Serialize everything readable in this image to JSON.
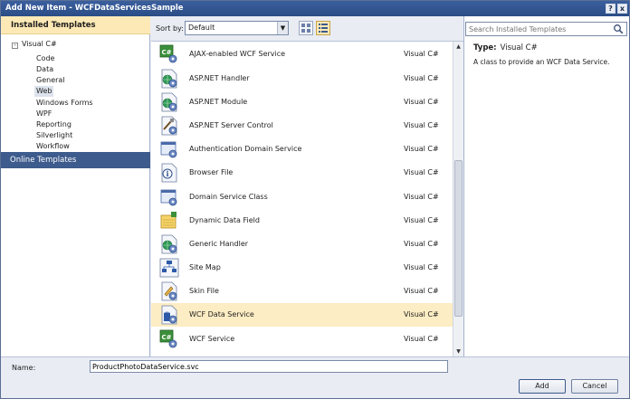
{
  "window": {
    "title": "Add New Item - WCFDataServicesSample",
    "help_label": "?",
    "close_label": "x"
  },
  "left": {
    "installed_header": "Installed Templates",
    "root": "Visual C#",
    "root_toggle": "-",
    "items": [
      {
        "label": "Code"
      },
      {
        "label": "Data"
      },
      {
        "label": "General"
      },
      {
        "label": "Web"
      },
      {
        "label": "Windows Forms"
      },
      {
        "label": "WPF"
      },
      {
        "label": "Reporting"
      },
      {
        "label": "Silverlight"
      },
      {
        "label": "Workflow"
      }
    ],
    "selected_index": 3,
    "online": "Online Templates"
  },
  "toolbar": {
    "sort_label": "Sort by:",
    "sort_value": "Default",
    "sort_arrow": "▼"
  },
  "templates": [
    {
      "name": "AJAX-enabled WCF Service",
      "lang": "Visual C#",
      "icon": "wcf-icon"
    },
    {
      "name": "ASP.NET Handler",
      "lang": "Visual C#",
      "icon": "handler-icon"
    },
    {
      "name": "ASP.NET Module",
      "lang": "Visual C#",
      "icon": "module-icon"
    },
    {
      "name": "ASP.NET Server Control",
      "lang": "Visual C#",
      "icon": "server-control-icon"
    },
    {
      "name": "Authentication Domain Service",
      "lang": "Visual C#",
      "icon": "domain-service-icon"
    },
    {
      "name": "Browser File",
      "lang": "Visual C#",
      "icon": "browser-file-icon"
    },
    {
      "name": "Domain Service Class",
      "lang": "Visual C#",
      "icon": "domain-class-icon"
    },
    {
      "name": "Dynamic Data Field",
      "lang": "Visual C#",
      "icon": "dynamic-data-icon"
    },
    {
      "name": "Generic Handler",
      "lang": "Visual C#",
      "icon": "generic-handler-icon"
    },
    {
      "name": "Site Map",
      "lang": "Visual C#",
      "icon": "site-map-icon"
    },
    {
      "name": "Skin File",
      "lang": "Visual C#",
      "icon": "skin-file-icon"
    },
    {
      "name": "WCF Data Service",
      "lang": "Visual C#",
      "icon": "wcf-data-service-icon"
    },
    {
      "name": "WCF Service",
      "lang": "Visual C#",
      "icon": "wcf-service-icon"
    }
  ],
  "selected_template": 11,
  "scroll": {
    "up": "▲",
    "down": "▼"
  },
  "search": {
    "placeholder": "Search Installed Templates"
  },
  "details": {
    "type_label": "Type:",
    "type_value": "Visual C#",
    "description": "A class to provide an WCF Data Service."
  },
  "bottom": {
    "name_label": "Name:",
    "name_value": "ProductPhotoDataService.svc",
    "add": "Add",
    "cancel": "Cancel"
  },
  "colors": {
    "selection": "#fdedc4",
    "header": "#fde9b6",
    "online_bg": "#3d5b8c",
    "titlebar": "#2b4d86"
  }
}
